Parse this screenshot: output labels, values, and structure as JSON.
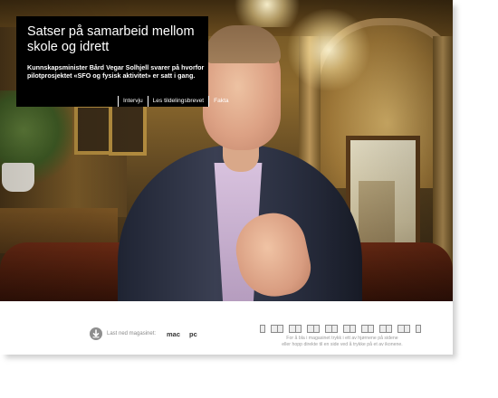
{
  "article": {
    "headline": "Satser på samarbeid mellom skole og idrett",
    "subtext": "Kunnskapsminister Bård Vegar Solhjell svarer på hvorfor pilotprosjektet «SFO og fysisk aktivitet» er satt i gang.",
    "tabs": [
      {
        "label": "Intervju"
      },
      {
        "label": "Les tildelingsbrevet"
      },
      {
        "label": "Fakta"
      }
    ]
  },
  "photo": {
    "icon": "photo-portrait"
  },
  "download": {
    "icon": "download-arrow-icon",
    "label": "Last ned magasinet:",
    "mac": "mac",
    "pc": "pc"
  },
  "pages": {
    "thumbnails": [
      "single",
      "spread",
      "spread",
      "spread",
      "spread",
      "spread",
      "spread",
      "spread",
      "spread",
      "single"
    ],
    "hint_line1": "For å bla i magasinet trykk i ett av hjørnene på sidene",
    "hint_line2": "eller hopp direkte til en side ved å trykke på et av ikonene."
  },
  "colors": {
    "headline_bg": "#000000",
    "headline_text": "#ffffff",
    "muted_text": "#9a9a9a"
  }
}
